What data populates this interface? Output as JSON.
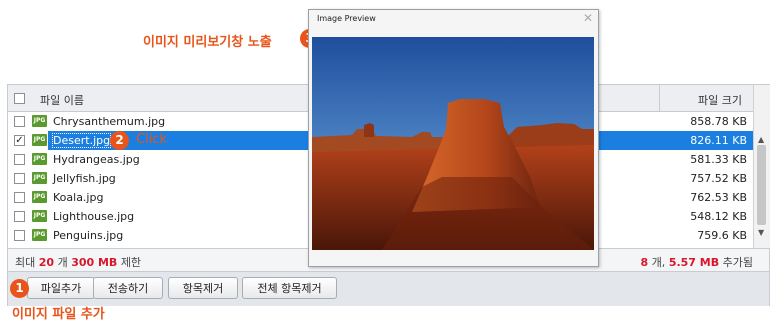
{
  "header": {
    "col_name": "파일 이름",
    "col_size": "파일 크기"
  },
  "files": [
    {
      "name": "Chrysanthemum.jpg",
      "size": "858.78 KB",
      "icon": "JPG",
      "checked": false
    },
    {
      "name": "Desert.jpg",
      "size": "826.11 KB",
      "icon": "JPG",
      "checked": true
    },
    {
      "name": "Hydrangeas.jpg",
      "size": "581.33 KB",
      "icon": "JPG",
      "checked": false
    },
    {
      "name": "Jellyfish.jpg",
      "size": "757.52 KB",
      "icon": "JPG",
      "checked": false
    },
    {
      "name": "Koala.jpg",
      "size": "762.53 KB",
      "icon": "JPG",
      "checked": false
    },
    {
      "name": "Lighthouse.jpg",
      "size": "548.12 KB",
      "icon": "JPG",
      "checked": false
    },
    {
      "name": "Penguins.jpg",
      "size": "759.6 KB",
      "icon": "JPG",
      "checked": false
    }
  ],
  "footer": {
    "limit_prefix": "최대",
    "max_count": "20",
    "count_unit": "개",
    "max_size": "300 MB",
    "limit_suffix": "제한",
    "added_count": "8",
    "added_unit": "개,",
    "added_size": "5.57 MB",
    "added_suffix": "추가됨"
  },
  "buttons": {
    "add_file": "파일추가",
    "send": "전송하기",
    "remove_item": "항목제거",
    "remove_all": "전체 항목제거"
  },
  "annotations": {
    "step1_num": "1",
    "step1_label": "이미지 파일 추가",
    "step2_num": "2",
    "step2_label": "Click",
    "step3_num": "3",
    "step3_label": "이미지 미리보기창 노출"
  },
  "preview": {
    "title": "Image Preview",
    "close_glyph": "✕"
  },
  "colors": {
    "accent": "#e8541a",
    "selection": "#1a7fe0",
    "limit_red": "#d6182a"
  }
}
